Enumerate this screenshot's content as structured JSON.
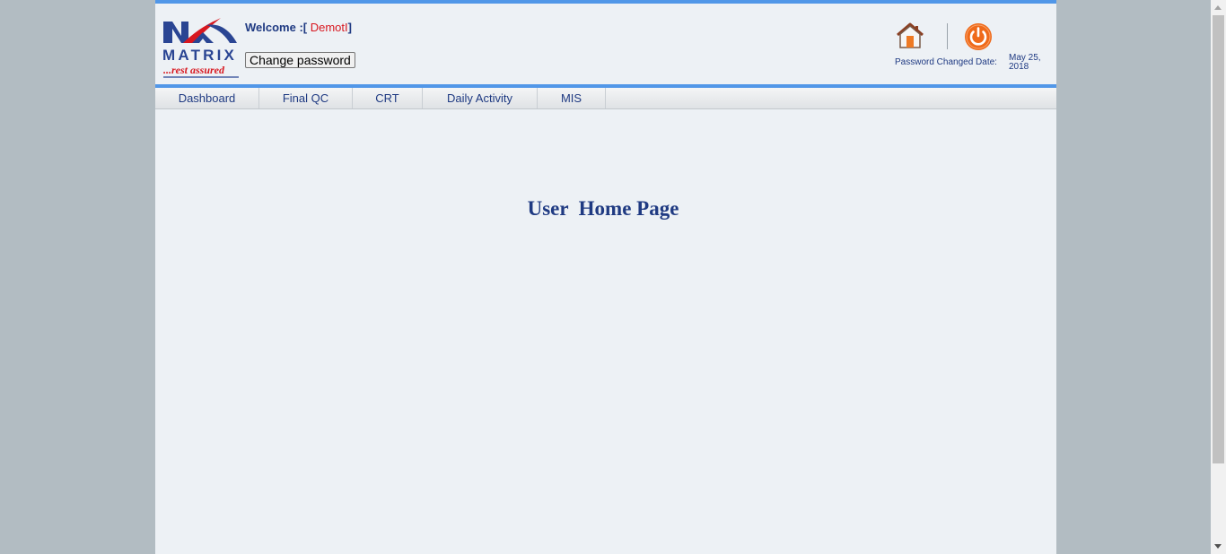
{
  "header": {
    "logo_top_text": "MATRIX",
    "logo_tagline": "...rest assured",
    "welcome_prefix": "Welcome :[",
    "welcome_user": " DemotI",
    "welcome_suffix": "]",
    "change_password_label": "Change password",
    "password_changed_label": "Password Changed Date:",
    "password_changed_date": "May 25, 2018"
  },
  "nav": {
    "items": [
      {
        "label": "Dashboard"
      },
      {
        "label": "Final QC"
      },
      {
        "label": "CRT"
      },
      {
        "label": "Daily Activity"
      },
      {
        "label": "MIS"
      }
    ]
  },
  "main": {
    "title": "User  Home Page"
  },
  "colors": {
    "accent_blue": "#5197e8",
    "text_navy": "#1f3a82",
    "brand_red": "#d8171f",
    "power_orange": "#ef6a1a"
  },
  "icons": {
    "home": "home-icon",
    "power": "power-icon"
  }
}
